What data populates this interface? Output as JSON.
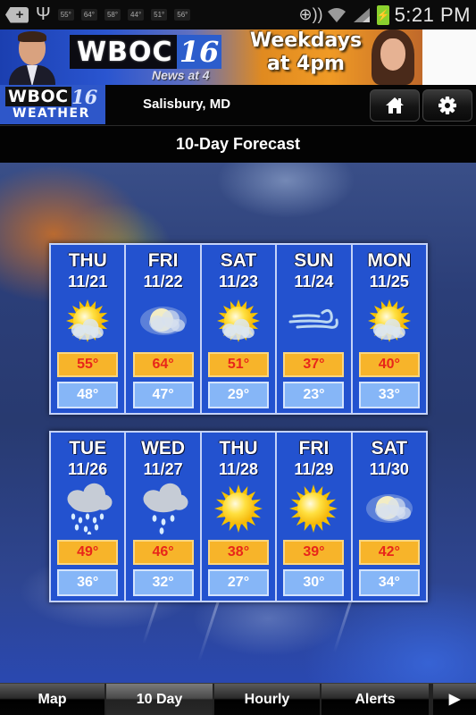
{
  "status_bar": {
    "notification_temps": [
      "55°",
      "64°",
      "58°",
      "44°",
      "51°",
      "56°"
    ],
    "time": "5:21 PM",
    "icons": [
      "notification-plus-icon",
      "usb-icon",
      "location-icon",
      "wifi-icon",
      "signal-icon",
      "battery-charging-icon"
    ]
  },
  "ad_banner": {
    "station": "WBOC",
    "channel": "16",
    "tagline": "News at 4",
    "promo_line1": "Weekdays",
    "promo_line2": "at 4pm"
  },
  "header": {
    "logo_station": "WBOC",
    "logo_channel": "16",
    "logo_subtitle": "WEATHER",
    "location": "Salisbury, MD",
    "home_icon": "home-icon",
    "settings_icon": "gear-icon"
  },
  "title": "10-Day Forecast",
  "forecast": [
    {
      "day": "THU",
      "date": "11/21",
      "condition": "partly-sunny",
      "high": "55°",
      "low": "48°"
    },
    {
      "day": "FRI",
      "date": "11/22",
      "condition": "cloudy",
      "high": "64°",
      "low": "47°"
    },
    {
      "day": "SAT",
      "date": "11/23",
      "condition": "partly-sunny",
      "high": "51°",
      "low": "29°"
    },
    {
      "day": "SUN",
      "date": "11/24",
      "condition": "windy",
      "high": "37°",
      "low": "23°"
    },
    {
      "day": "MON",
      "date": "11/25",
      "condition": "partly-sunny",
      "high": "40°",
      "low": "33°"
    },
    {
      "day": "TUE",
      "date": "11/26",
      "condition": "rain",
      "high": "49°",
      "low": "36°"
    },
    {
      "day": "WED",
      "date": "11/27",
      "condition": "showers",
      "high": "46°",
      "low": "32°"
    },
    {
      "day": "THU",
      "date": "11/28",
      "condition": "sunny",
      "high": "38°",
      "low": "27°"
    },
    {
      "day": "FRI",
      "date": "11/29",
      "condition": "sunny",
      "high": "39°",
      "low": "30°"
    },
    {
      "day": "SAT",
      "date": "11/30",
      "condition": "cloudy",
      "high": "42°",
      "low": "34°"
    }
  ],
  "tabs": [
    {
      "label": "Map",
      "active": false
    },
    {
      "label": "10 Day",
      "active": true
    },
    {
      "label": "Hourly",
      "active": false
    },
    {
      "label": "Alerts",
      "active": false
    },
    {
      "label": "▶",
      "active": false
    }
  ],
  "colors": {
    "card_blue": "#2352cf",
    "high_bg": "#f7b42a",
    "high_text": "#e8261a",
    "low_bg": "#86b6f7",
    "logo_blue": "#2e57c9"
  }
}
